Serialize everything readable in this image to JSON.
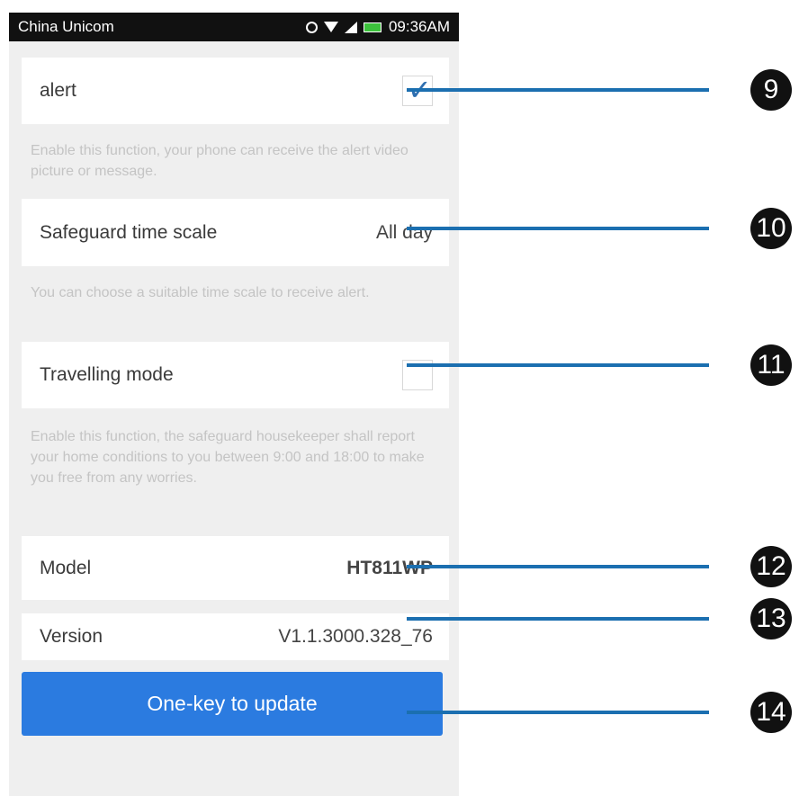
{
  "status_bar": {
    "carrier": "China Unicom",
    "time": "09:36AM",
    "icons": [
      "alarm-icon",
      "wifi-icon",
      "signal-icon",
      "battery-icon"
    ]
  },
  "settings": {
    "alert": {
      "label": "alert",
      "checked": true,
      "hint": "Enable this function, your phone can receive the alert video picture or message."
    },
    "safeguard_time_scale": {
      "label": "Safeguard time scale",
      "value": "All day",
      "hint": "You can choose a suitable time scale to receive alert."
    },
    "travelling_mode": {
      "label": "Travelling mode",
      "checked": false,
      "hint": "Enable this function, the safeguard housekeeper shall report your home conditions to you between 9:00 and 18:00 to make you free from any worries."
    },
    "model": {
      "label": "Model",
      "value": "HT811WP"
    },
    "version": {
      "label": "Version",
      "value": "V1.1.3000.328_76"
    }
  },
  "update_button": {
    "label": "One-key to update"
  },
  "callouts": [
    "9",
    "10",
    "11",
    "12",
    "13",
    "14"
  ],
  "colors": {
    "accent": "#2b7be0",
    "callout_line": "#1b6fb0",
    "check": "#2f6fb0",
    "background": "#efefef"
  }
}
